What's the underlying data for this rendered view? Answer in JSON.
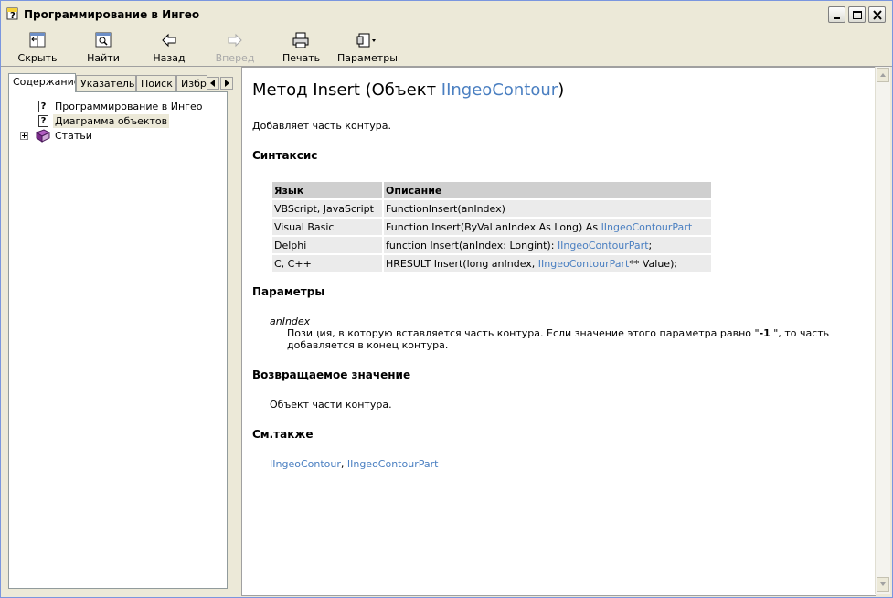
{
  "window": {
    "title": "Программирование в Ингео"
  },
  "toolbar": {
    "hide_label": "Скрыть",
    "find_label": "Найти",
    "back_label": "Назад",
    "forward_label": "Вперед",
    "print_label": "Печать",
    "options_label": "Параметры"
  },
  "nav": {
    "tabs": [
      "Содержание",
      "Указатель",
      "Поиск",
      "Избр"
    ],
    "tree": [
      {
        "label": "Программирование в Ингео",
        "icon": "help-page-icon"
      },
      {
        "label": "Диаграмма объектов",
        "icon": "help-page-icon",
        "selected": true
      },
      {
        "label": "Статьи",
        "icon": "book-icon",
        "expandable": true
      }
    ]
  },
  "topic": {
    "title_prefix": "Метод Insert (Объект ",
    "title_link": "IIngeoContour",
    "title_suffix": ")",
    "summary": "Добавляет часть контура.",
    "syntax_heading": "Синтаксис",
    "syntax_table": {
      "headers": [
        "Язык",
        "Описание"
      ],
      "rows": [
        {
          "lang": "VBScript, JavaScript",
          "pre": "FunctionInsert(anIndex)",
          "link": "",
          "post": ""
        },
        {
          "lang": "Visual Basic",
          "pre": "Function Insert(ByVal anIndex As Long) As ",
          "link": "IIngeoContourPart",
          "post": ""
        },
        {
          "lang": "Delphi",
          "pre": "function Insert(anIndex: Longint): ",
          "link": "IIngeoContourPart",
          "post": ";"
        },
        {
          "lang": "C, C++",
          "pre": "HRESULT Insert(long anIndex, ",
          "link": "IIngeoContourPart",
          "post": "** Value);"
        }
      ]
    },
    "params_heading": "Параметры",
    "param_name": "anIndex",
    "param_desc_a": "Позиция, в которую вставляется часть контура. Если значение этого параметра равно \"",
    "param_desc_bold": "-1",
    "param_desc_b": " \", то часть",
    "param_desc_line2": "добавляется в конец контура.",
    "return_heading": "Возвращаемое значение",
    "return_text": "Объект части контура.",
    "see_also_heading": "См.также",
    "see_also_links": [
      "IIngeoContour",
      "IIngeoContourPart"
    ],
    "see_also_sep": ", "
  },
  "colors": {
    "link": "#4a7fc1",
    "table_header": "#cfcfcf",
    "table_cell": "#ebebeb",
    "chrome": "#ece9d8"
  }
}
